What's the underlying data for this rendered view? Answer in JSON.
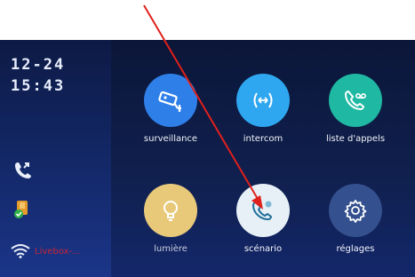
{
  "status": {
    "date": "12-24",
    "time": "15:43",
    "wifi_network": "Livebox-..."
  },
  "apps": [
    {
      "label": "surveillance",
      "icon": "cctv-camera-icon",
      "color": "#2f7fe8"
    },
    {
      "label": "intercom",
      "icon": "intercom-arrows-icon",
      "color": "#2ea6f0"
    },
    {
      "label": "liste d'appels",
      "icon": "call-log-icon",
      "color": "#1fb8a2"
    },
    {
      "label": "lumière",
      "icon": "light-bulb-icon",
      "color": "#e8c97a"
    },
    {
      "label": "scénario",
      "icon": "phone-scenario-icon",
      "color": "#e6f0f6"
    },
    {
      "label": "réglages",
      "icon": "gear-icon",
      "color": "#34508e"
    }
  ],
  "colors": {
    "annotation_arrow": "#e0201c",
    "wifi_label": "#c8253a"
  }
}
